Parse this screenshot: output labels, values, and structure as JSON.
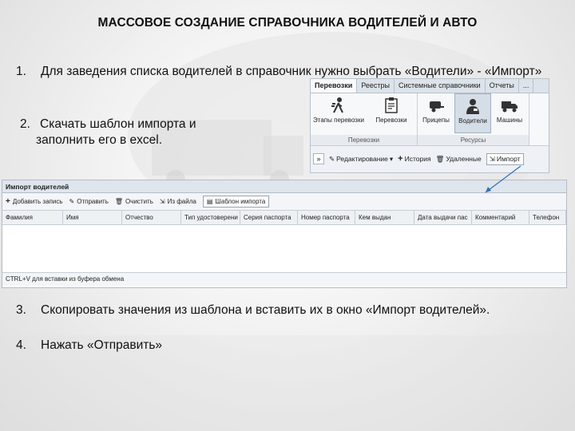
{
  "title": "МАССОВОЕ СОЗДАНИЕ СПРАВОЧНИКА ВОДИТЕЛЕЙ И АВТО",
  "steps": {
    "s1_num": "1.",
    "s1_text": "Для заведения списка водителей в справочник нужно выбрать «Водители» - «Импорт»",
    "s2_num": "2.",
    "s2_text_a": "Скачать шаблон импорта и",
    "s2_text_b": "заполнить его в excel.",
    "s3_num": "3.",
    "s3_text": "Скопировать значения из шаблона и вставить их в окно «Импорт водителей».",
    "s4_num": "4.",
    "s4_text": "Нажать «Отправить»"
  },
  "ribbon": {
    "tabs": [
      "Перевозки",
      "Реестры",
      "Системные справочники",
      "Отчеты",
      "..."
    ],
    "group1_name": "Перевозки",
    "group2_name": "Ресурсы",
    "buttons": [
      "Этапы перевозки",
      "Перевозки",
      "Прицепы",
      "Водители",
      "Машины"
    ],
    "tool_expand": "»",
    "tool_edit": "Редактирование",
    "tool_history": "История",
    "tool_deleted": "Удаленные",
    "tool_import": "Импорт",
    "icons": [
      "walker-icon",
      "clipboard-icon",
      "trailer-icon",
      "driver-icon",
      "truck-icon"
    ]
  },
  "import_window": {
    "title": "Импорт водителей",
    "tools": [
      "Добавить запись",
      "Отправить",
      "Очистить",
      "Из файла",
      "Шаблон импорта"
    ],
    "columns": [
      "Фамилия",
      "Имя",
      "Отчество",
      "Тип удостоверени",
      "Серия паспорта",
      "Номер паспорта",
      "Кем выдан",
      "Дата выдачи пас",
      "Комментарий",
      "Телефон"
    ],
    "footer": "CTRL+V для вставки из буфера обмена"
  },
  "colors": {
    "accent": "#2f6db5",
    "ribbon_bg": "#eef1f5"
  }
}
